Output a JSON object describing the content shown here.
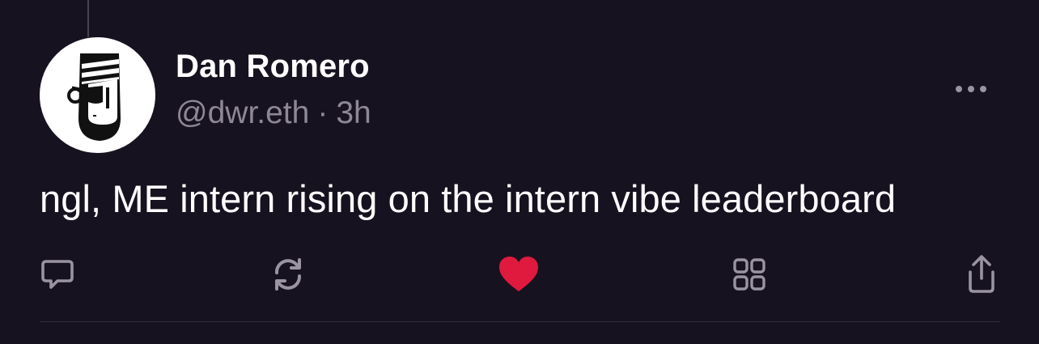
{
  "post": {
    "author_name": "Dan Romero",
    "handle": "@dwr.eth",
    "separator": "·",
    "time_ago": "3h",
    "text": "ngl, ME intern rising on the intern vibe leaderboard",
    "liked": true
  },
  "icons": {
    "more": "more-horizontal-icon",
    "reply": "comment-icon",
    "recast": "recast-icon",
    "like": "heart-icon",
    "apps": "grid-icon",
    "share": "share-icon"
  },
  "colors": {
    "background": "#17121f",
    "text_primary": "#ffffff",
    "text_secondary": "#8e8796",
    "icon": "#9a93a3",
    "like_active": "#e0193f"
  }
}
